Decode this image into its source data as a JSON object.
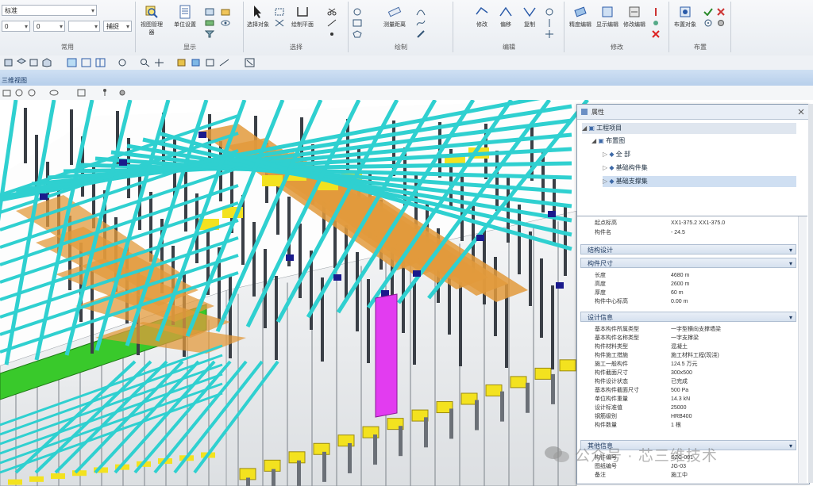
{
  "toolbar": {
    "style_combo_value": "标准",
    "size_combo_value": "0",
    "angle_combo_value": "0",
    "ratio_combo_value": "",
    "layer_combo_value": "捕捉",
    "groups": [
      "常用",
      "显示",
      "选择",
      "绘制",
      "编辑",
      "修改",
      "布置"
    ],
    "buttons": {
      "view_manager": "视图管理器",
      "unit_setting": "单位设置",
      "select_object": "选择对象",
      "working_plane": "绘制平面",
      "measure": "测量距离",
      "modify_a": "修改",
      "modify_b": "偏移",
      "modify_c": "复制",
      "edit_a": "精度编辑",
      "edit_b": "显示编辑",
      "edit_c": "修改编辑",
      "place_a": "布置对象"
    }
  },
  "view": {
    "title": "三维视图"
  },
  "panel": {
    "title": "属性",
    "tree": {
      "root": "工程项目",
      "child": "布置图",
      "items": [
        "全 部",
        "基础构件集",
        "基础支撑集"
      ]
    },
    "top_props": [
      {
        "k": "起点标高",
        "v": "XX1-375.2  XX1-375.0"
      },
      {
        "k": "构件名",
        "v": "- 24.5"
      }
    ],
    "collapsed_section": "结构设计",
    "section_size": {
      "title": "构件尺寸",
      "rows": [
        {
          "k": "长度",
          "v": "4680 m"
        },
        {
          "k": "高度",
          "v": "2600 m"
        },
        {
          "k": "厚度",
          "v": "60 m"
        },
        {
          "k": "构件中心标高",
          "v": "0.00 m"
        }
      ]
    },
    "section_design": {
      "title": "设计信息",
      "rows": [
        {
          "k": "基本构件所属类型",
          "v": "一字型横向支撑墙梁"
        },
        {
          "k": "基本构件名称类型",
          "v": "一字支撑梁"
        },
        {
          "k": "构件材料类型",
          "v": "混凝土"
        },
        {
          "k": "构件施工措施",
          "v": "施工材料工程(现浇)"
        },
        {
          "k": "施工一般构件",
          "v": "124.5 万元"
        },
        {
          "k": "构件截面尺寸",
          "v": "300x500"
        },
        {
          "k": "构件设计状态",
          "v": "已完成"
        },
        {
          "k": "基本构件截面尺寸",
          "v": "500 Pa"
        },
        {
          "k": "单位构件重量",
          "v": "14.3 kN"
        },
        {
          "k": "设计标准值",
          "v": "25000"
        },
        {
          "k": "钢筋级别",
          "v": "HRB400"
        },
        {
          "k": "构件数量",
          "v": "1 根"
        }
      ]
    },
    "section_extra": {
      "title": "其他信息",
      "rows": [
        {
          "k": "构件编号",
          "v": "SZC-001"
        },
        {
          "k": "图纸编号",
          "v": "JG-03"
        },
        {
          "k": "备注",
          "v": "施工中"
        }
      ]
    }
  },
  "watermark": "公众号 · 芯三维技术",
  "colors": {
    "beam_cyan": "#2fd0d0",
    "beam_orange": "#e29a3c",
    "yellow": "#f3e21f",
    "green": "#39c92b",
    "magenta": "#e23cf0",
    "navy": "#1a1a8c",
    "column_dark": "#3a3f46",
    "wall_grey": "#eceff1"
  }
}
